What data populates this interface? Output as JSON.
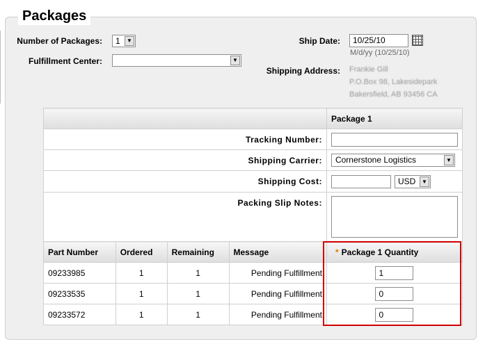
{
  "page_title": "Packages",
  "form": {
    "num_packages_label": "Number of Packages:",
    "num_packages_value": "1",
    "fulfillment_center_label": "Fulfillment Center:",
    "fulfillment_center_value": "",
    "ship_date_label": "Ship Date:",
    "ship_date_value": "10/25/10",
    "ship_date_hint": "M/d/yy (10/25/10)",
    "shipping_address_label": "Shipping Address:",
    "shipping_address_lines": [
      "Frankie Gill",
      "P.O.Box 98, Lakesidepark",
      "Bakersfield, AB 93456 CA"
    ]
  },
  "package": {
    "header": "Package 1",
    "tracking_label": "Tracking Number:",
    "tracking_value": "",
    "carrier_label": "Shipping Carrier:",
    "carrier_value": "Cornerstone Logistics",
    "cost_label": "Shipping Cost:",
    "cost_value": "",
    "currency_value": "USD",
    "notes_label": "Packing Slip Notes:",
    "notes_value": ""
  },
  "items": {
    "columns": [
      "Part Number",
      "Ordered",
      "Remaining",
      "Message",
      "Package 1 Quantity"
    ],
    "rows": [
      {
        "part": "09233985",
        "ordered": "1",
        "remaining": "1",
        "message": "Pending Fulfillment",
        "qty": "1"
      },
      {
        "part": "09233535",
        "ordered": "1",
        "remaining": "1",
        "message": "Pending Fulfillment",
        "qty": "0"
      },
      {
        "part": "09233572",
        "ordered": "1",
        "remaining": "1",
        "message": "Pending Fulfillment",
        "qty": "0"
      }
    ],
    "required_marker": "*"
  },
  "colors": {
    "highlight": "#d00000",
    "required": "#e07800"
  }
}
